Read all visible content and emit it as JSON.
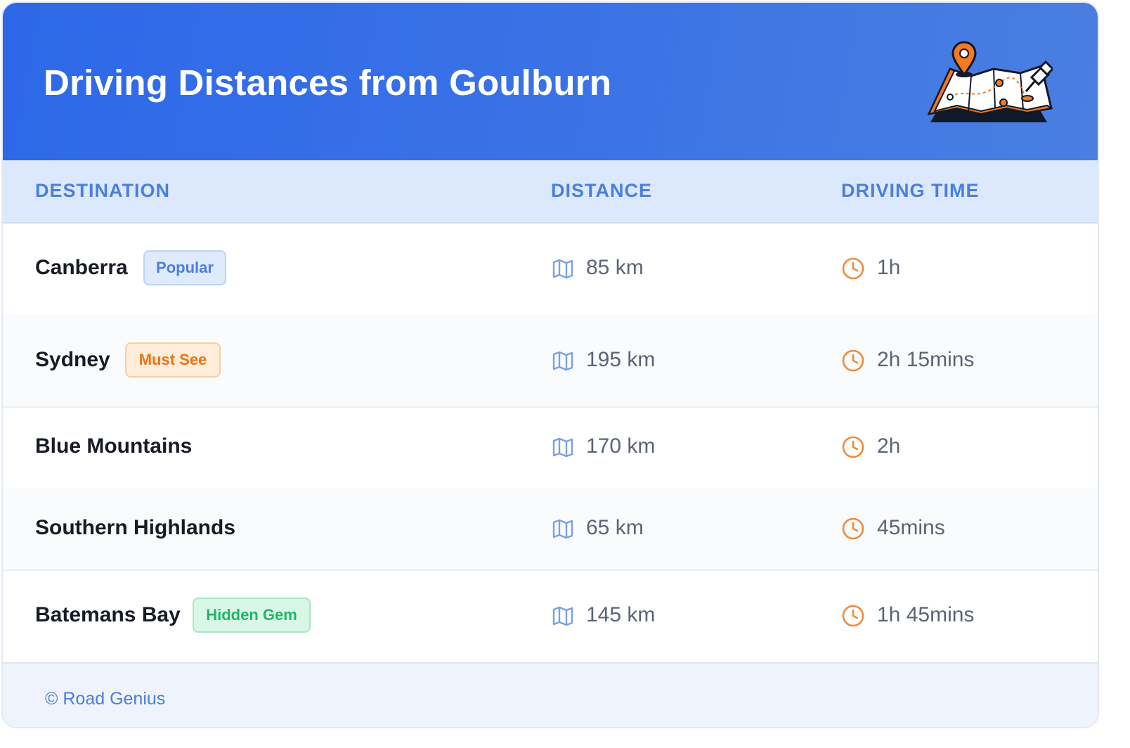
{
  "header": {
    "title": "Driving Distances from Goulburn",
    "illustration_icon": "map-with-pins-icon"
  },
  "table": {
    "columns": [
      "DESTINATION",
      "DISTANCE",
      "DRIVING TIME"
    ],
    "distance_icon": "map-icon",
    "time_icon": "clock-icon",
    "rows": [
      {
        "destination": "Canberra",
        "badge": "Popular",
        "badge_color": "#4a7fdd",
        "distance": "85 km",
        "time": "1h"
      },
      {
        "destination": "Sydney",
        "badge": "Must See",
        "badge_color": "#ee7218",
        "distance": "195 km",
        "time": "2h 15mins"
      },
      {
        "destination": "Blue Mountains",
        "badge": null,
        "distance": "170 km",
        "time": "2h"
      },
      {
        "destination": "Southern Highlands",
        "badge": null,
        "distance": "65 km",
        "time": "45mins"
      },
      {
        "destination": "Batemans Bay",
        "badge": "Hidden Gem",
        "badge_color": "#22b56a",
        "distance": "145 km",
        "time": "1h 45mins"
      }
    ]
  },
  "footer": {
    "text": "© Road Genius"
  },
  "colors": {
    "header_gradient_start": "#2d68e8",
    "header_gradient_end": "#4a7fe0",
    "accent": "#4a7fdd",
    "clock": "#f08a3c"
  }
}
